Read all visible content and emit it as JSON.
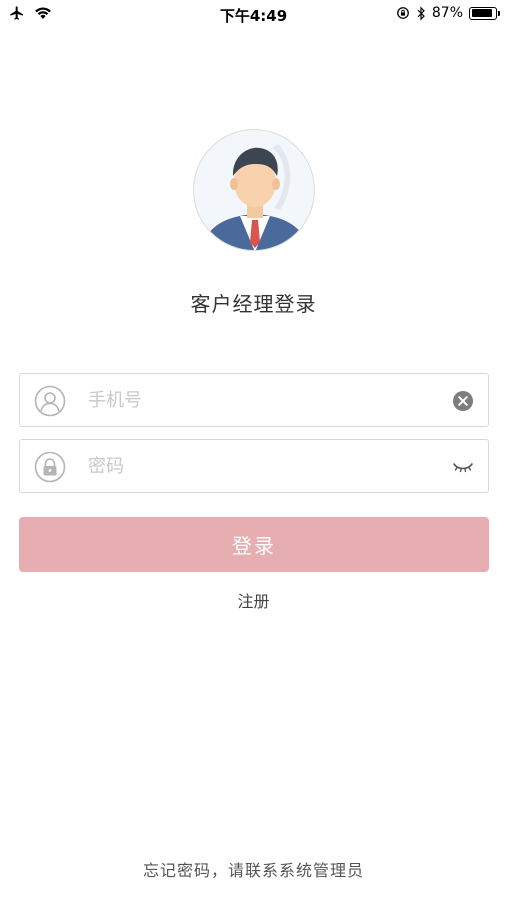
{
  "status_bar": {
    "time": "下午4:49",
    "battery_percent": "87%",
    "battery_level": 0.87,
    "icons": [
      "airplane-icon",
      "wifi-icon",
      "rotation-lock-icon",
      "bluetooth-icon",
      "battery-icon"
    ]
  },
  "login": {
    "title": "客户经理登录",
    "phone_placeholder": "手机号",
    "phone_value": "",
    "password_placeholder": "密码",
    "password_value": "",
    "submit_label": "登录",
    "register_label": "注册",
    "footer_note": "忘记密码，请联系系统管理员"
  },
  "colors": {
    "button": "#e7aeb1",
    "tie": "#d9534f",
    "suit": "#4a6a9c"
  }
}
